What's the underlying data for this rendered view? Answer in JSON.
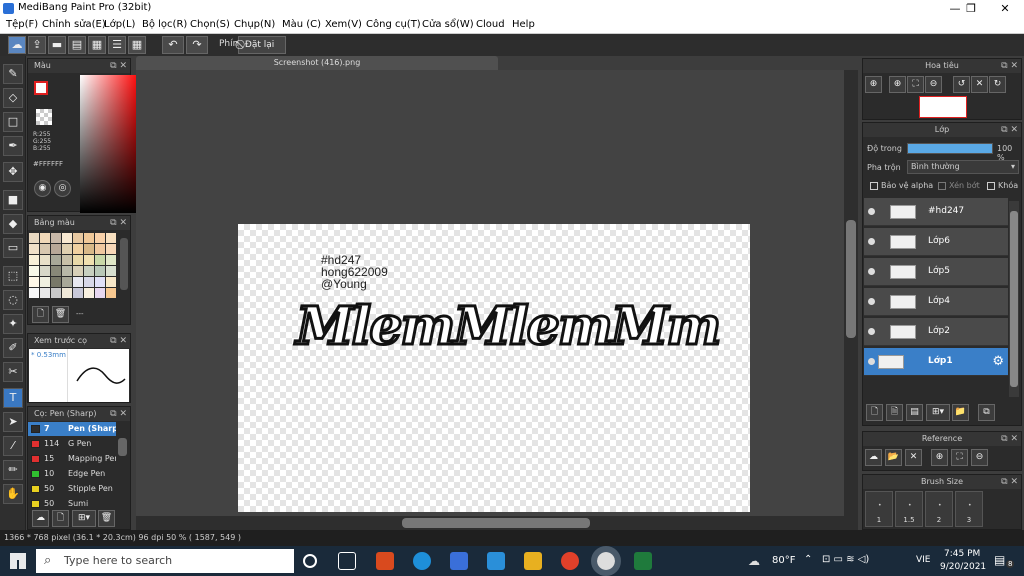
{
  "window": {
    "title": "MediBang Paint Pro (32bit)",
    "minimize": "—",
    "maximize": "❐",
    "close": "✕"
  },
  "menu": [
    "Tệp(F)",
    "Chỉnh sửa(E)",
    "Lớp(L)",
    "Bộ lọc(R)",
    "Chọn(S)",
    "Chụp(N)",
    "Màu (C)",
    "Xem(V)",
    "Công cụ(T)",
    "Cửa sổ(W)",
    "Cloud",
    "Help"
  ],
  "toolbar": {
    "undo": "↶",
    "redo": "↷",
    "key_label": "Phím",
    "reset_label": "Đặt lại"
  },
  "color_panel": {
    "title": "Màu",
    "r": "R:255",
    "g": "G:255",
    "b": "B:255",
    "hex": "#FFFFFF",
    "primary_color": "#ffffff"
  },
  "palette_panel": {
    "title": "Bảng màu",
    "footer": "---"
  },
  "preview_panel": {
    "title": "Xem trước cọ",
    "size": "* 0.53mm"
  },
  "brush_panel": {
    "title": "Cọ: Pen (Sharp)",
    "items": [
      {
        "size": "7",
        "name": "Pen (Sharp)",
        "color": "#2d2d2d",
        "selected": true
      },
      {
        "size": "114",
        "name": "G Pen",
        "color": "#e03030"
      },
      {
        "size": "15",
        "name": "Mapping Pen",
        "color": "#e03030"
      },
      {
        "size": "10",
        "name": "Edge Pen",
        "color": "#30c030"
      },
      {
        "size": "50",
        "name": "Stipple Pen",
        "color": "#e8d020"
      },
      {
        "size": "50",
        "name": "Sumi",
        "color": "#e8d020"
      }
    ]
  },
  "document": {
    "tab": "Screenshot (416).png"
  },
  "canvas_text": {
    "line1": "#hd247",
    "line2": "hong622009",
    "line3": "@Young",
    "lettering": "MlemMlemMm"
  },
  "navigator": {
    "title": "Hoa tiêu"
  },
  "layer_panel": {
    "title": "Lớp",
    "opacity_label": "Độ trong",
    "opacity_value": "100 %",
    "opacity": 1.0,
    "blend_label": "Pha trộn",
    "blend_value": "Bình thường",
    "protect_alpha": "Bảo vệ alpha",
    "clipping": "Xén bớt",
    "lock": "Khóa",
    "layers": [
      "#hd247",
      "Lớp6",
      "Lớp5",
      "Lớp4",
      "Lớp2",
      "Lớp1"
    ]
  },
  "reference_panel": {
    "title": "Reference"
  },
  "brush_size_panel": {
    "title": "Brush Size",
    "sizes": [
      "1",
      "1.5",
      "2",
      "3"
    ]
  },
  "status": {
    "text": "1366 * 768 pixel   (36.1 * 20.3cm)   96 dpi   50 %   ( 1587, 549 )"
  },
  "taskbar": {
    "search_placeholder": "Type here to search",
    "weather": "80°F",
    "lang": "VIE",
    "time": "7:45 PM",
    "date": "9/20/2021",
    "notif": "8"
  }
}
